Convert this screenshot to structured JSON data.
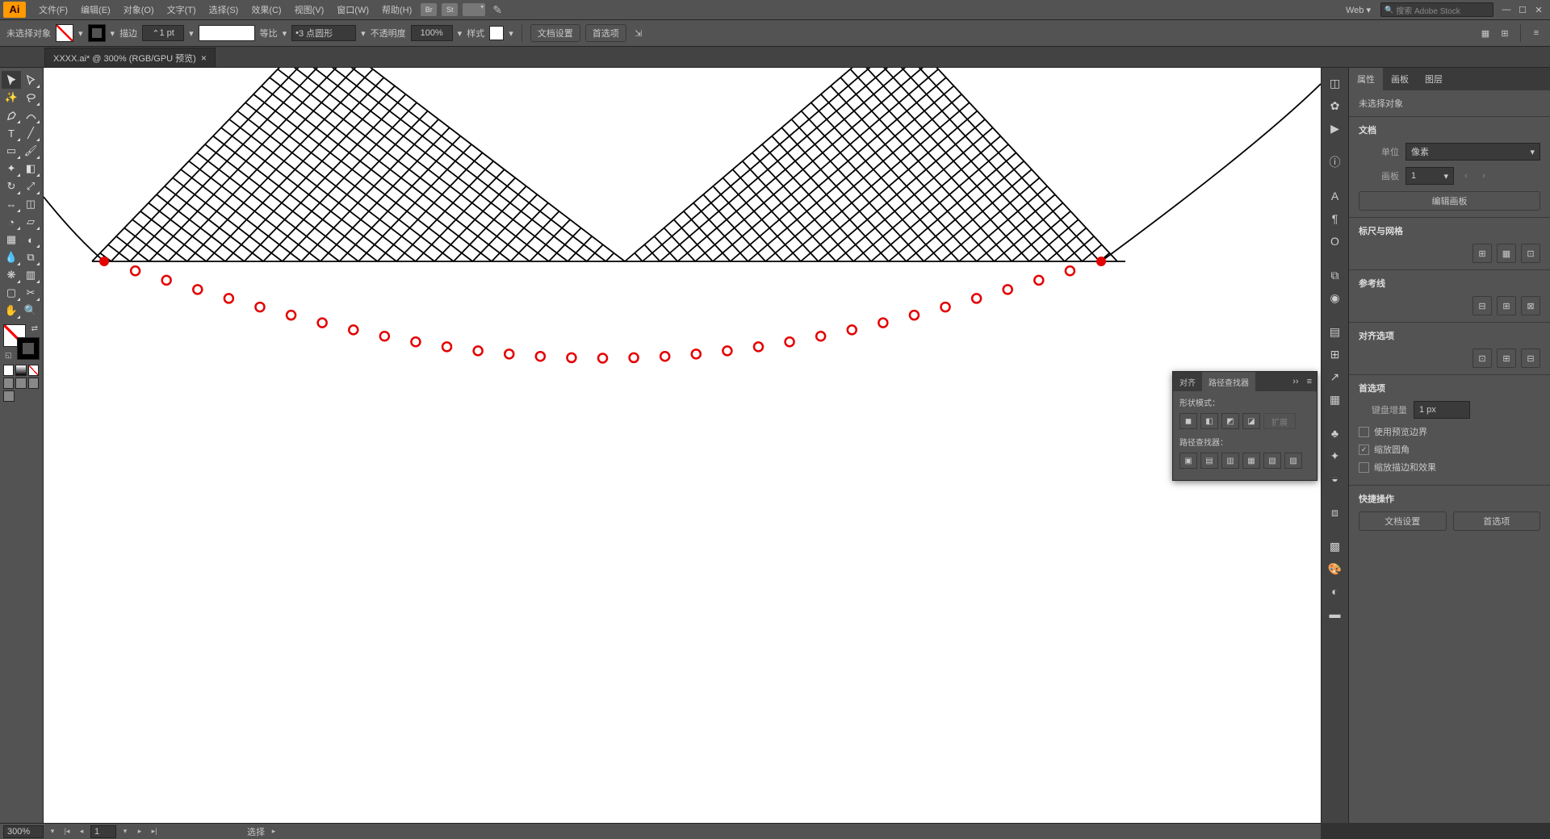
{
  "menu": {
    "items": [
      "文件(F)",
      "编辑(E)",
      "对象(O)",
      "文字(T)",
      "选择(S)",
      "效果(C)",
      "视图(V)",
      "窗口(W)",
      "帮助(H)"
    ],
    "br": "Br",
    "st": "St",
    "web": "Web",
    "search": "搜索 Adobe Stock"
  },
  "ctrl": {
    "nosel": "未选择对象",
    "stroke": "描边",
    "strokeVal": "1 pt",
    "dash": "等比",
    "profile": "3 点圆形",
    "opacity": "不透明度",
    "opacityVal": "100%",
    "style": "样式",
    "docset": "文档设置",
    "prefs": "首选项"
  },
  "tab": {
    "name": "XXXX.ai* @ 300% (RGB/GPU 预览)"
  },
  "prop": {
    "tabs": [
      "属性",
      "画板",
      "图层"
    ],
    "nosel": "未选择对象",
    "doc": "文档",
    "units": "单位",
    "unitsVal": "像素",
    "artboard": "画板",
    "artboardVal": "1",
    "editAB": "编辑画板",
    "ruler": "标尺与网格",
    "guides": "参考线",
    "snap": "对齐选项",
    "prefs": "首选项",
    "keyinc": "键盘增量",
    "keyincVal": "1 px",
    "chk1": "使用预览边界",
    "chk2": "缩放圆角",
    "chk3": "缩放描边和效果",
    "quick": "快捷操作",
    "docset": "文档设置",
    "prefBtn": "首选项"
  },
  "float": {
    "tabs": [
      "对齐",
      "路径查找器"
    ],
    "shape": "形状模式：",
    "pf": "路径查找器：",
    "expand": "扩展"
  },
  "status": {
    "zoom": "300%",
    "ab": "1",
    "tool": "选择"
  }
}
